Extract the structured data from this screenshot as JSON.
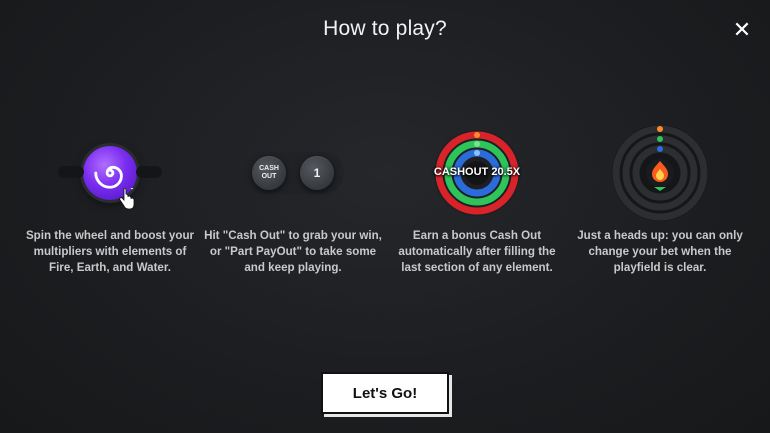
{
  "dialog": {
    "title": "How to play?",
    "close_symbol": "✕"
  },
  "steps": [
    {
      "icon": "swirl-wheel-icon",
      "description": "Spin the wheel and boost your multipliers with elements of Fire, Earth, and Water."
    },
    {
      "icon": "cashout-buttons-icon",
      "buttons": [
        "CASH OUT",
        "1"
      ],
      "description": "Hit \"Cash Out\" to grab your win, or \"Part PayOut\" to take some and keep playing."
    },
    {
      "icon": "bonus-rings-icon",
      "overlay_text": "CASHOUT 20.5X",
      "description": "Earn a bonus Cash Out automatically after filling the last section of any element."
    },
    {
      "icon": "playfield-fire-icon",
      "description": "Just a heads up: you can only change your bet when the playfield is clear."
    }
  ],
  "cta": {
    "label": "Let's Go!"
  },
  "colors": {
    "background": "#1b1d20",
    "purple": "#7a2df0",
    "ring_red": "#d8232a",
    "ring_green": "#2ec45a",
    "ring_blue": "#2a6cd9",
    "fire": "#ff5a1f"
  }
}
